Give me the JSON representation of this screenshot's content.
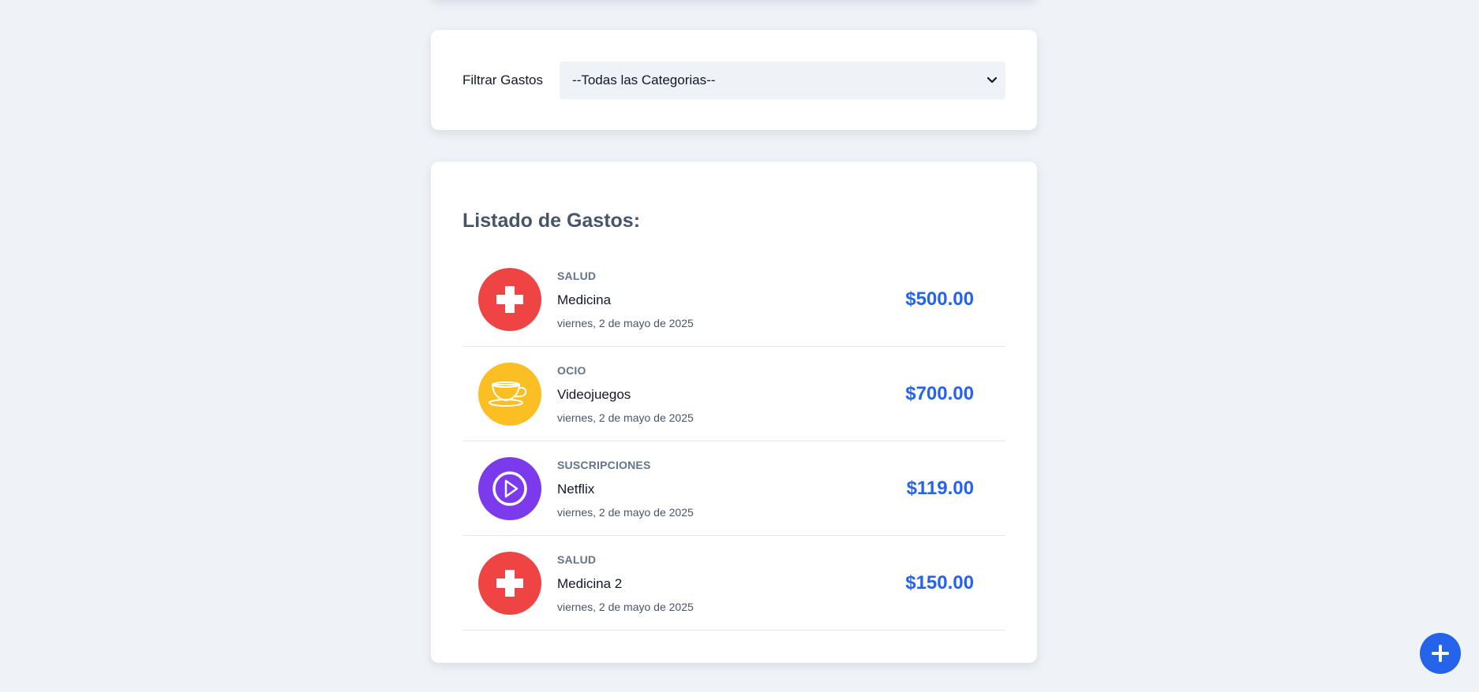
{
  "filter": {
    "label": "Filtrar Gastos",
    "selected": "--Todas las Categorias--"
  },
  "list": {
    "title": "Listado de Gastos:",
    "items": [
      {
        "category": "Salud",
        "name": "Medicina",
        "date": "viernes, 2 de mayo de 2025",
        "amount": "$500.00",
        "icon": "medical-cross-icon",
        "color": "#ef4444"
      },
      {
        "category": "Ocio",
        "name": "Videojuegos",
        "date": "viernes, 2 de mayo de 2025",
        "amount": "$700.00",
        "icon": "teacup-icon",
        "color": "#fbbf24"
      },
      {
        "category": "Suscripciones",
        "name": "Netflix",
        "date": "viernes, 2 de mayo de 2025",
        "amount": "$119.00",
        "icon": "play-icon",
        "color": "#7c3aed"
      },
      {
        "category": "Salud",
        "name": "Medicina 2",
        "date": "viernes, 2 de mayo de 2025",
        "amount": "$150.00",
        "icon": "medical-cross-icon",
        "color": "#ef4444"
      }
    ]
  },
  "colors": {
    "background": "#eff3f8",
    "accent": "#2563eb"
  }
}
